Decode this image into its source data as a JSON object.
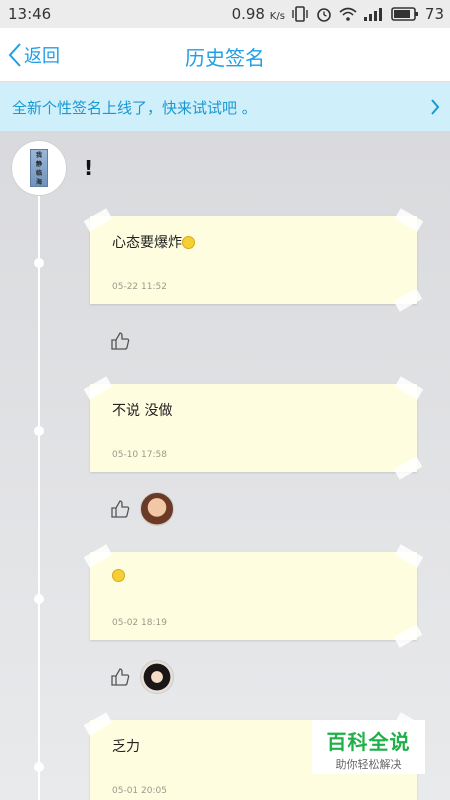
{
  "status_bar": {
    "time": "13:46",
    "net_speed": "0.98",
    "net_unit": "K/s",
    "battery": "73"
  },
  "nav": {
    "back_label": "返回",
    "title": "历史签名"
  },
  "banner": {
    "text": "全新个性签名上线了，快来试试吧 。"
  },
  "profile": {
    "avatar_text": [
      "我",
      "静",
      "临",
      "海"
    ],
    "name": "!"
  },
  "signatures": [
    {
      "text": "心态要爆炸",
      "emoji": "smile-emoji",
      "date": "05-22 11:52",
      "likers": []
    },
    {
      "text": "不说 没做",
      "emoji": "",
      "date": "05-10 17:58",
      "likers": [
        "liker-avatar"
      ]
    },
    {
      "text": "",
      "emoji": "smile-emoji",
      "date": "05-02 18:19",
      "likers": [
        "liker-avatar"
      ]
    },
    {
      "text": "乏力",
      "emoji": "",
      "date": "05-01 20:05",
      "likers": []
    }
  ],
  "watermark": {
    "main": "百科全说",
    "sub": "助你轻松解决"
  },
  "colors": {
    "accent": "#1ea0e8",
    "banner_bg": "#cfeffb",
    "card_bg": "#fffde0",
    "watermark_green": "#20b04a"
  }
}
